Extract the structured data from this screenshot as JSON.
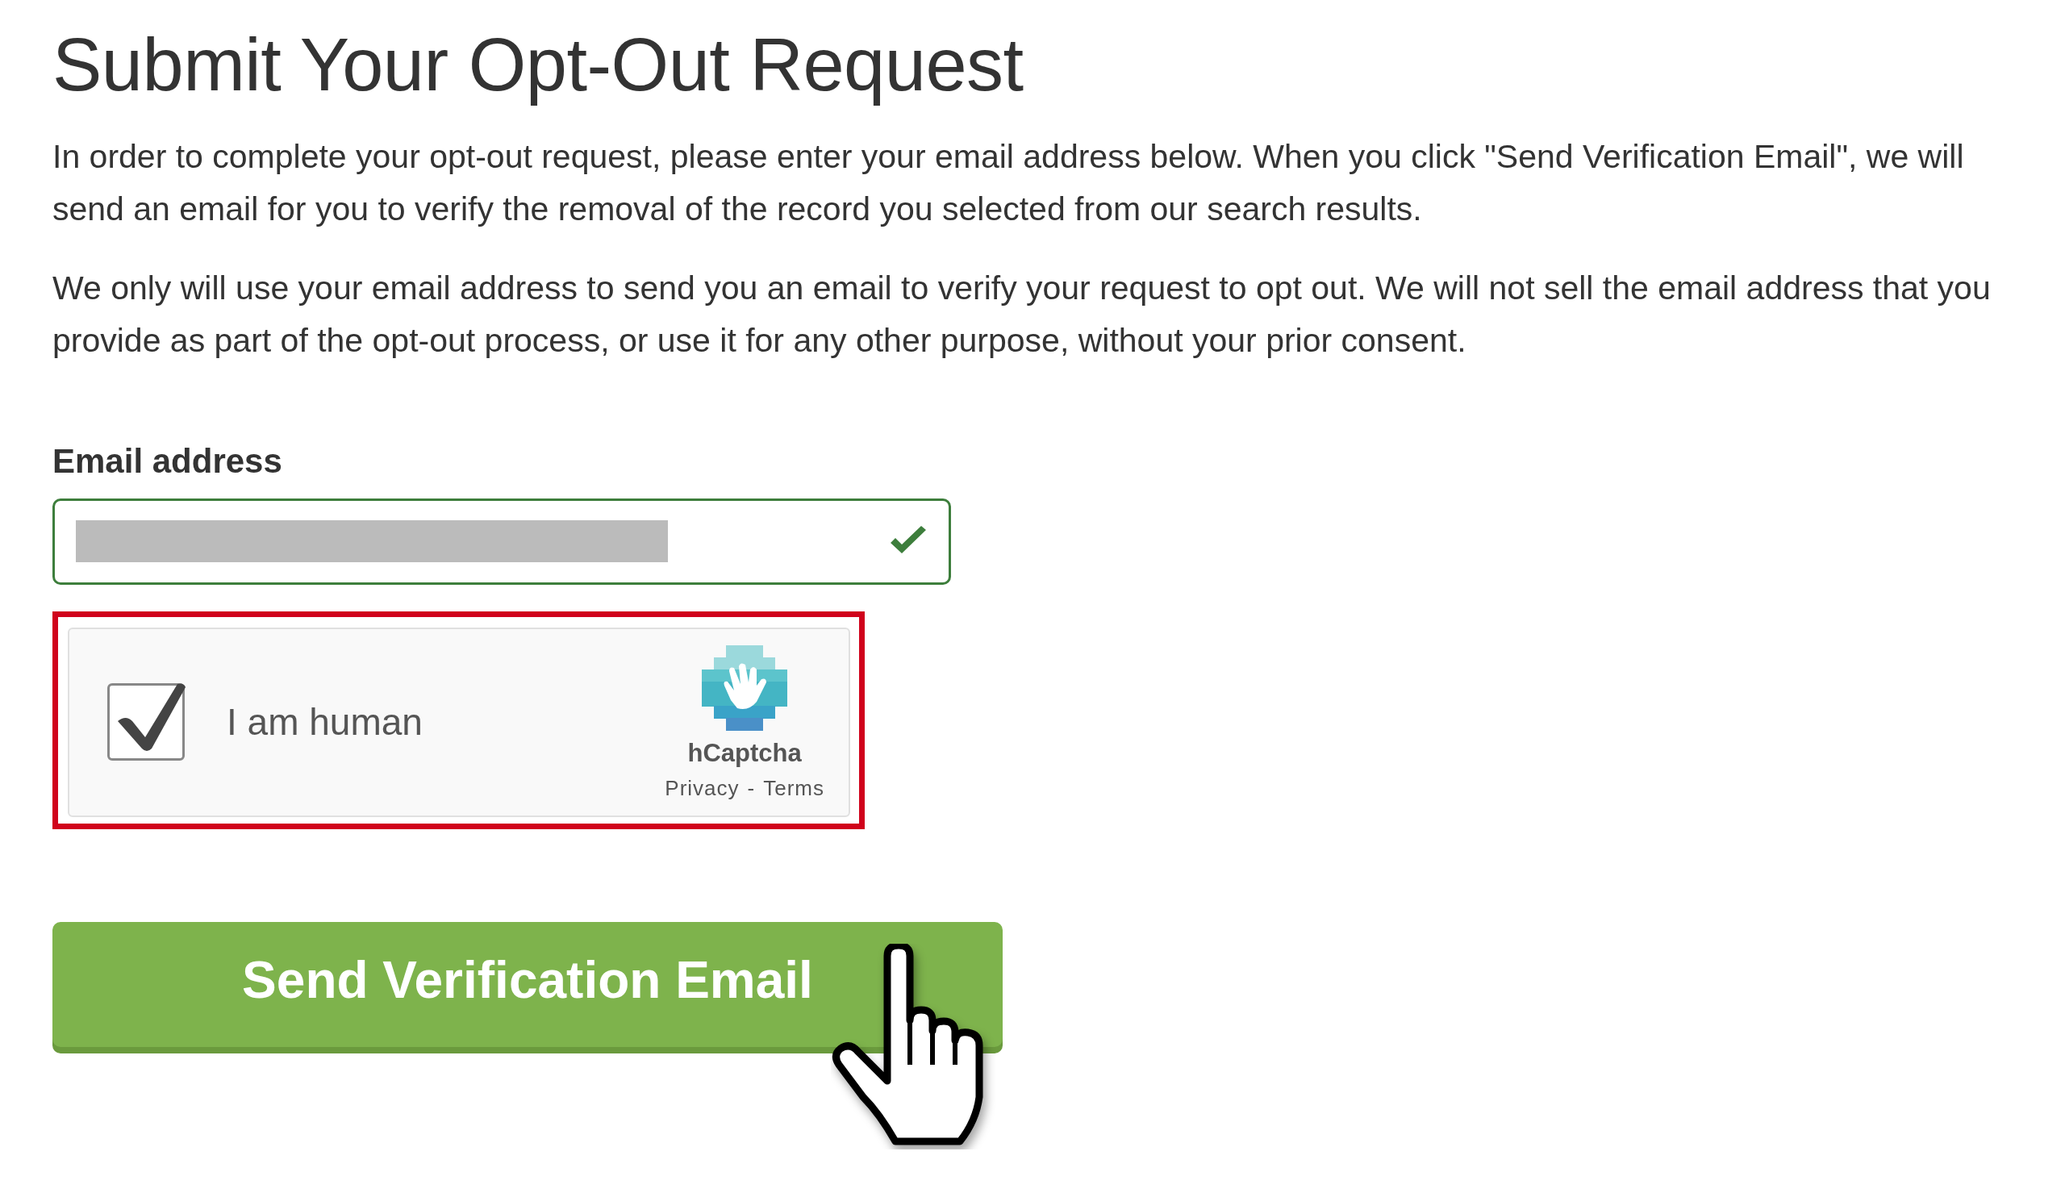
{
  "title": "Submit Your Opt-Out Request",
  "paragraphs": [
    "In order to complete your opt-out request, please enter your email address below. When you click \"Send Verification Email\", we will send an email for you to verify the removal of the record you selected from our search results.",
    "We only will use your email address to send you an email to verify your request to opt out. We will not sell the email address that you provide as part of the opt-out process, or use it for any other purpose, without your prior consent."
  ],
  "email_field": {
    "label": "Email address",
    "valid": true,
    "redacted": true
  },
  "captcha": {
    "highlighted": true,
    "checked": true,
    "label": "I am human",
    "brand": "hCaptcha",
    "links": [
      "Privacy",
      "-",
      "Terms"
    ]
  },
  "submit_button": {
    "label": "Send Verification Email"
  }
}
